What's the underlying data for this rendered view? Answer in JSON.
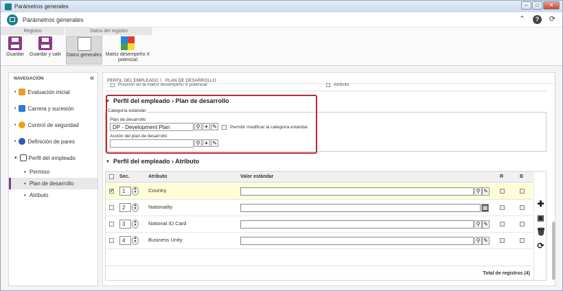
{
  "window": {
    "title": "Parámetros generales",
    "btn_min": "–",
    "btn_max": "□",
    "btn_close": "✕"
  },
  "app": {
    "title": "Parámetros generales"
  },
  "ribbon": {
    "groups": [
      "Registro",
      "Datos del registro"
    ],
    "save": "Guardar",
    "save_exit": "Guardar y salir",
    "general": "Datos generales",
    "matrix_line1": "Matriz desempeño X",
    "matrix_line2": "potencial"
  },
  "nav": {
    "header": "NAVEGACIÓN",
    "collapse": "«",
    "items": [
      {
        "label": "Evaluación inicial",
        "icon": "evaluation-icon"
      },
      {
        "label": "Carrera y sucesión",
        "icon": "career-icon"
      },
      {
        "label": "Control de seguridad",
        "icon": "key-icon"
      },
      {
        "label": "Definición de pares",
        "icon": "users-icon"
      },
      {
        "label": "Perfil del empleado",
        "icon": "profile-icon"
      }
    ],
    "subitems": [
      "Permiso",
      "Plan de desarrollo",
      "Atributo"
    ]
  },
  "breadcrumb": "PERFIL DEL EMPLEADO  〉 PLAN DE DESARROLLO",
  "cutrow": {
    "left": "Posición en la matriz desempeño X potencial",
    "right": "Atributo"
  },
  "dev_section": {
    "title": "Perfil del empleado › Plan de desarrollo",
    "legend": "Categoría estándar",
    "plan_label": "Plan de desarrollo",
    "plan_value": "DP - Development Plan",
    "allow_label": "Permitir modificar la categoría estándar",
    "action_label": "Acción del plan de desarrollo",
    "action_value": ""
  },
  "attr_section": {
    "title": "Perfil del empleado › Atributo",
    "columns": {
      "seq": "Sec.",
      "attr": "Atributo",
      "value": "Valor estándar",
      "r": "R",
      "b": "B"
    },
    "rows": [
      {
        "seq": "1",
        "attr": "Country",
        "checked": true
      },
      {
        "seq": "2",
        "attr": "Nationality",
        "checked": false
      },
      {
        "seq": "3",
        "attr": "National ID Card",
        "checked": false
      },
      {
        "seq": "4",
        "attr": "Business Unity",
        "checked": false
      }
    ],
    "total": "Total de registros (4)"
  },
  "colors": {
    "accent": "#7b3d91",
    "highlight": "#c0262b",
    "row_hl": "#fdfdd6"
  }
}
